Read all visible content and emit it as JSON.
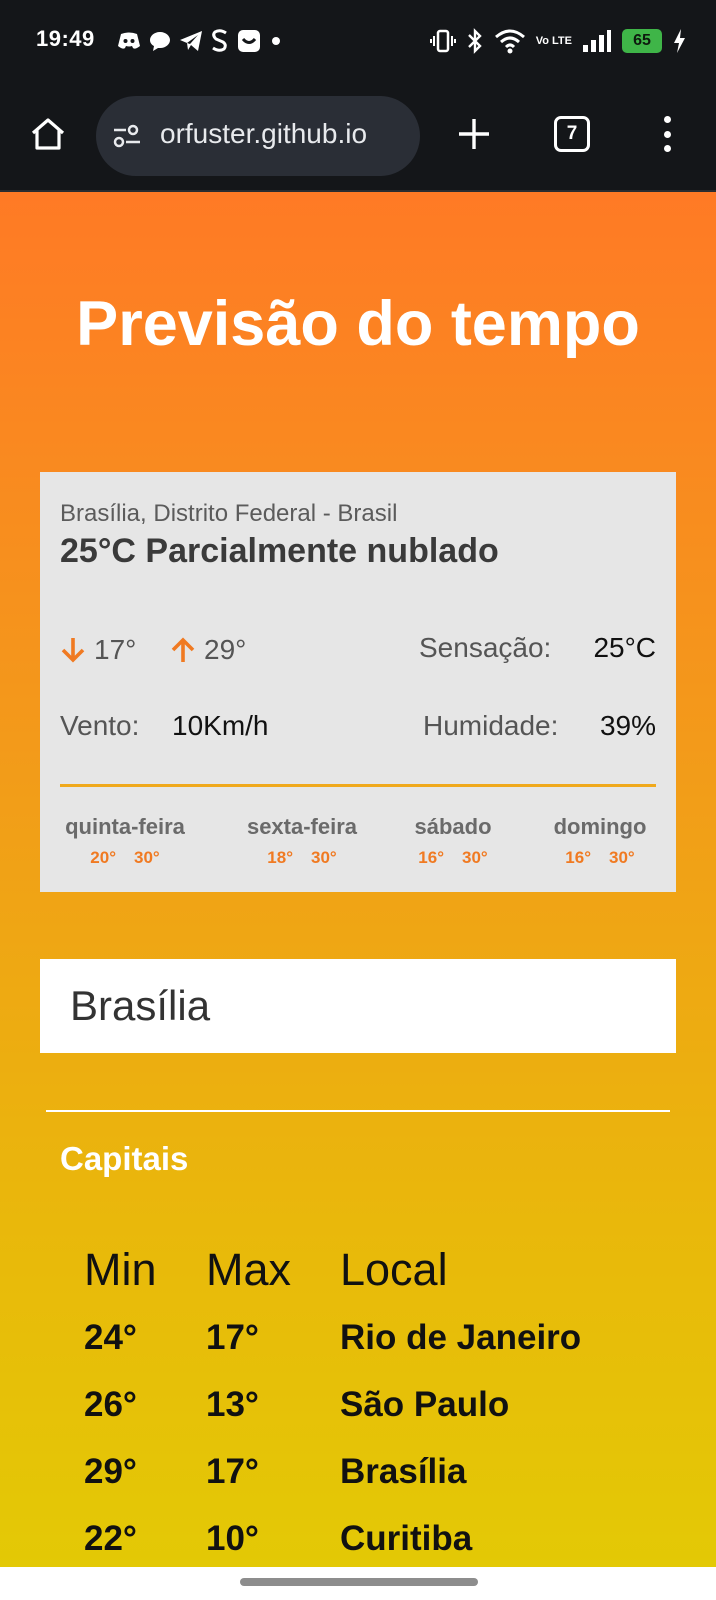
{
  "status_bar": {
    "time": "19:49",
    "app_icons": [
      "discord-icon",
      "chat-bubble-icon",
      "telegram-icon",
      "s-app-icon",
      "messenger-icon",
      "dot-icon"
    ],
    "volte": "Vo LTE",
    "battery": "65"
  },
  "browser": {
    "url": "orfuster.github.io",
    "tab_count": "7"
  },
  "page": {
    "title": "Previsão do tempo"
  },
  "weather": {
    "location": "Brasília, Distrito Federal - Brasil",
    "condition": "25°C Parcialmente nublado",
    "min": "17°",
    "max": "29°",
    "feels_label": "Sensação:",
    "feels_value": "25°C",
    "wind_label": "Vento:",
    "wind_value": "10Km/h",
    "humidity_label": "Humidade:",
    "humidity_value": "39%",
    "forecast": [
      {
        "day": "quinta-feira",
        "min": "20°",
        "max": "30°"
      },
      {
        "day": "sexta-feira",
        "min": "18°",
        "max": "30°"
      },
      {
        "day": "sábado",
        "min": "16°",
        "max": "30°"
      },
      {
        "day": "domingo",
        "min": "16°",
        "max": "30°"
      }
    ],
    "accent_color": "#f07a22"
  },
  "search": {
    "value": "Brasília"
  },
  "capitals": {
    "title": "Capitais",
    "headers": {
      "min": "Min",
      "max": "Max",
      "local": "Local"
    },
    "rows": [
      {
        "min": "24°",
        "max": "17°",
        "local": "Rio de Janeiro"
      },
      {
        "min": "26°",
        "max": "13°",
        "local": "São Paulo"
      },
      {
        "min": "29°",
        "max": "17°",
        "local": "Brasília"
      },
      {
        "min": "22°",
        "max": "10°",
        "local": "Curitiba"
      }
    ]
  }
}
